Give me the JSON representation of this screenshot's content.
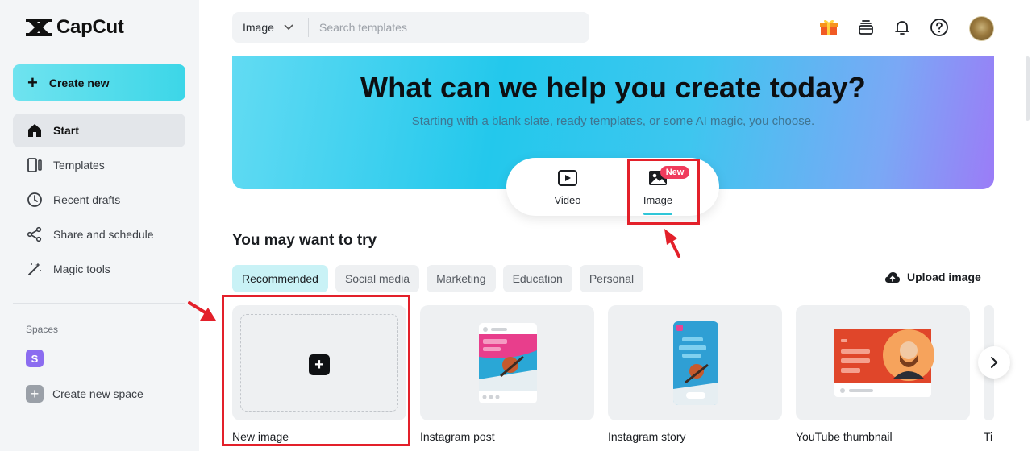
{
  "brand": {
    "name": "CapCut",
    "logo_icon": "capcut-logo-icon"
  },
  "sidebar": {
    "create_label": "Create new",
    "items": [
      {
        "label": "Start",
        "icon": "home-icon",
        "active": true
      },
      {
        "label": "Templates",
        "icon": "templates-icon"
      },
      {
        "label": "Recent drafts",
        "icon": "clock-icon"
      },
      {
        "label": "Share and schedule",
        "icon": "share-icon"
      },
      {
        "label": "Magic tools",
        "icon": "magic-wand-icon"
      }
    ],
    "spaces_title": "Spaces",
    "space_badge": "S",
    "new_space_label": "Create new space"
  },
  "search": {
    "type_value": "Image",
    "placeholder": "Search templates"
  },
  "header_icons": [
    "gift-icon",
    "stack-icon",
    "bell-icon",
    "help-icon",
    "avatar"
  ],
  "hero": {
    "title": "What can we help you create today?",
    "subtitle": "Starting with a blank slate, ready templates, or some AI magic, you choose.",
    "tabs": [
      {
        "label": "Video",
        "icon": "video-play-icon"
      },
      {
        "label": "Image",
        "icon": "image-icon",
        "badge": "New",
        "active": true
      }
    ]
  },
  "section": {
    "title": "You may want to try",
    "chips": [
      "Recommended",
      "Social media",
      "Marketing",
      "Education",
      "Personal"
    ],
    "active_chip": "Recommended",
    "upload_label": "Upload image"
  },
  "cards": [
    {
      "label": "New image"
    },
    {
      "label": "Instagram post"
    },
    {
      "label": "Instagram story"
    },
    {
      "label": "YouTube thumbnail"
    },
    {
      "label": "Ti"
    }
  ],
  "colors": {
    "accent": "#2fc6d8",
    "highlight": "#e3202a",
    "badge": "#f03b5c"
  }
}
